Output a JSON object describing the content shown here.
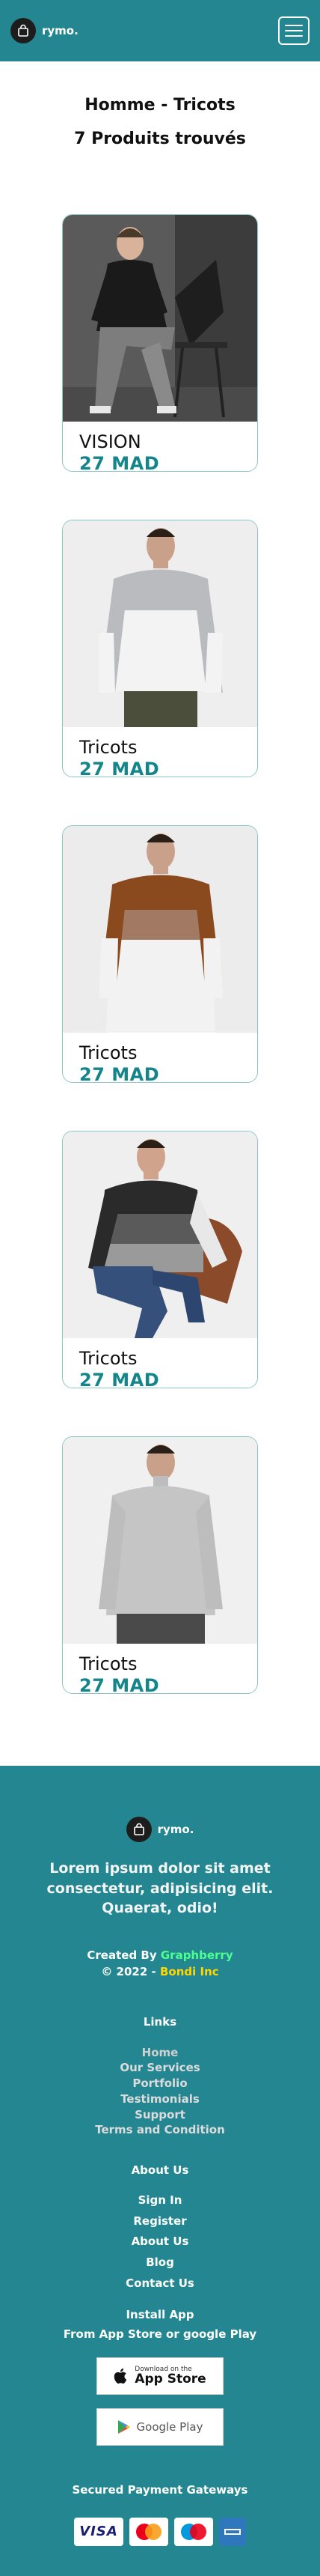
{
  "header": {
    "brand": "rymo.",
    "menu_icon": "hamburger-menu-icon"
  },
  "page": {
    "title": "Homme - Tricots",
    "results": "7 Produits trouvés"
  },
  "products": [
    {
      "name": "VISION",
      "price": "27 MAD"
    },
    {
      "name": "Tricots",
      "price": "27 MAD"
    },
    {
      "name": "Tricots",
      "price": "27 MAD"
    },
    {
      "name": "Tricots",
      "price": "27 MAD"
    },
    {
      "name": "Tricots",
      "price": "27 MAD"
    }
  ],
  "footer": {
    "brand": "rymo.",
    "tagline": "Lorem ipsum dolor sit amet consectetur, adipisicing elit. Quaerat, odio!",
    "created_by_label": "Created By",
    "created_by_name": "Graphberry",
    "copyright_prefix": "© 2022 -",
    "company": "Bondi Inc",
    "links_title": "Links",
    "links": [
      "Home",
      "Our Services",
      "Portfolio",
      "Testimonials",
      "Support",
      "Terms and Condition"
    ],
    "about_title": "About Us",
    "about_links": [
      "Sign In",
      "Register",
      "About Us",
      "Blog",
      "Contact Us"
    ],
    "install_title": "Install App",
    "install_sub": "From App Store or google Play",
    "appstore_small": "Download on the",
    "appstore_big": "App Store",
    "googleplay": "Google Play",
    "payment_title": "Secured Payment Gateways",
    "payment_visa": "VISA",
    "payment_amex": "AMERICAN EXPRESS"
  },
  "colors": {
    "teal": "#238690",
    "price": "#14868b",
    "accent_green": "#4cff8f",
    "accent_yellow": "#ffd600"
  }
}
